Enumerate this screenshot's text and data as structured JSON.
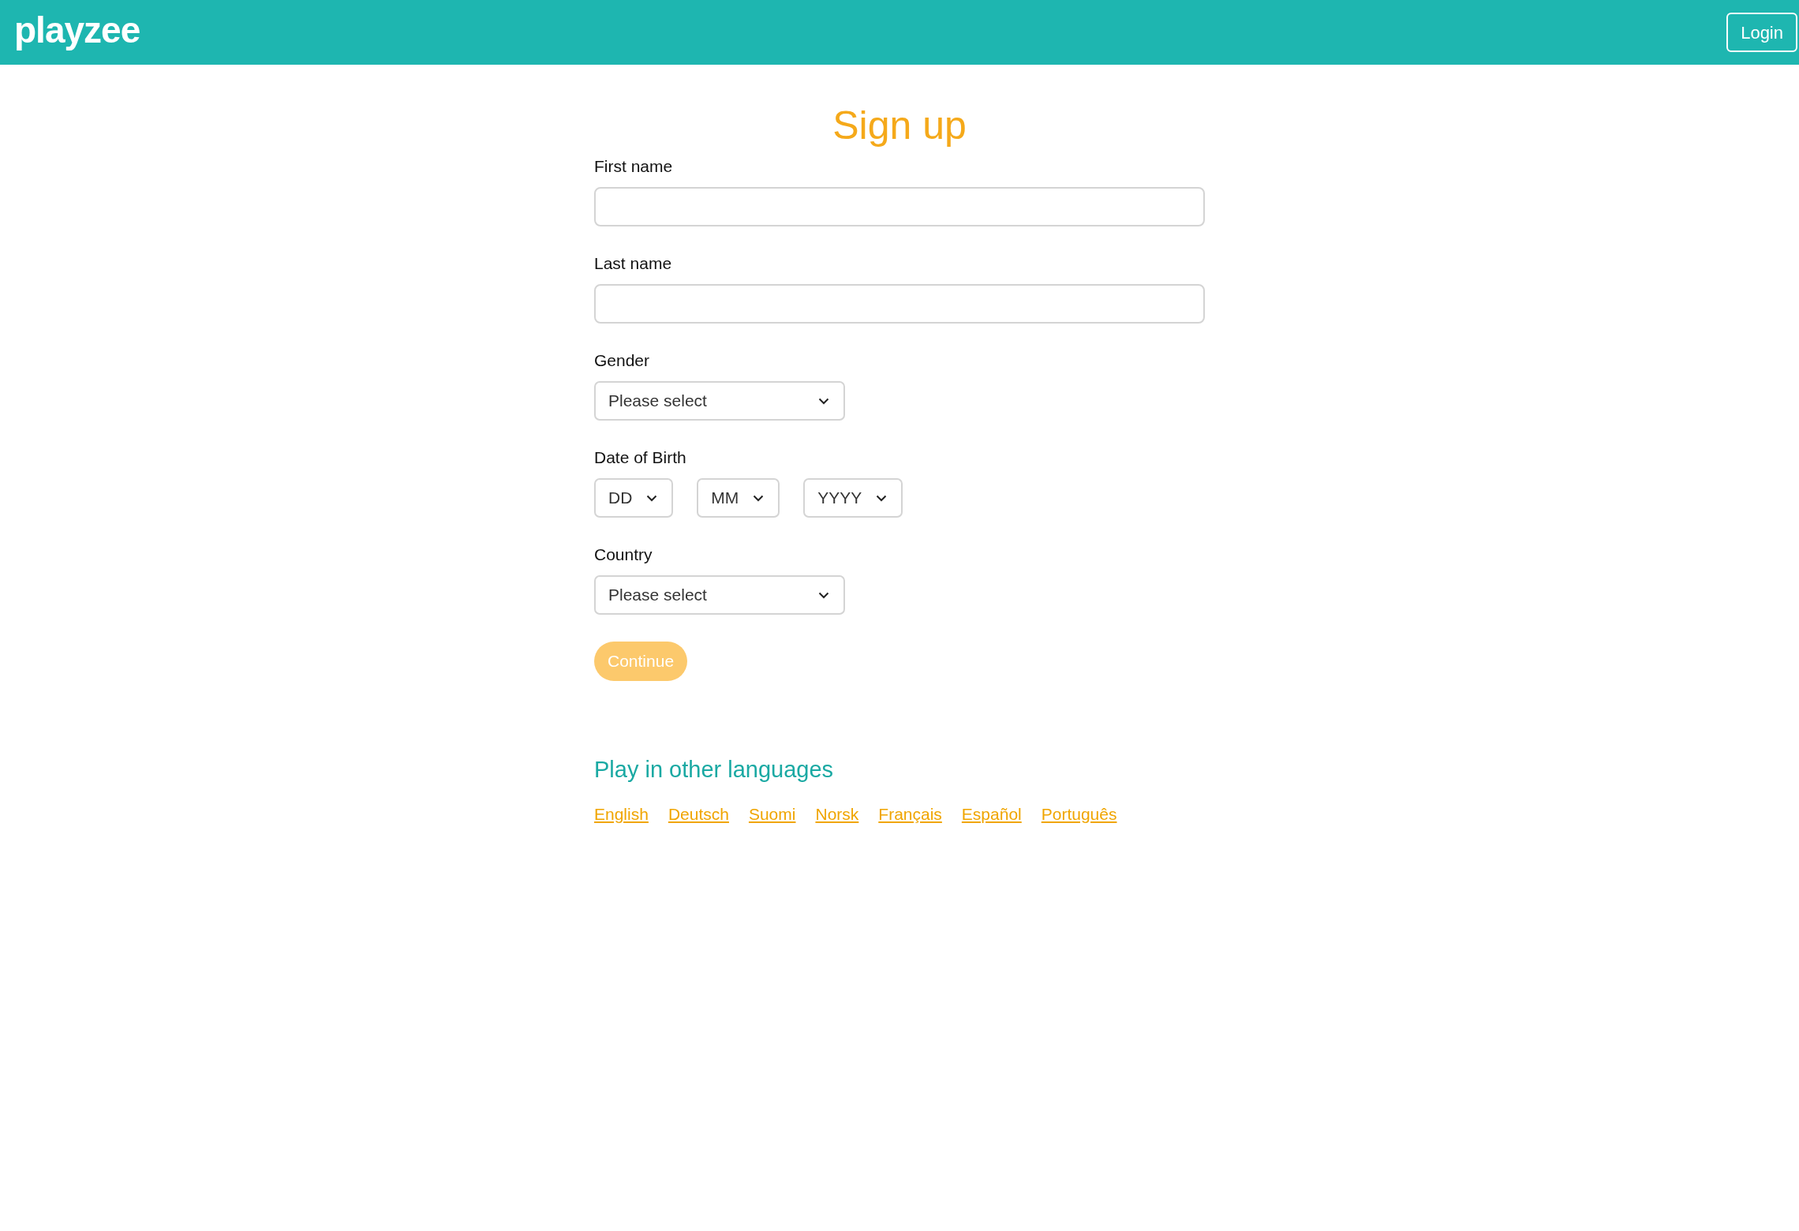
{
  "header": {
    "logo": "playzee",
    "login_button": "Login"
  },
  "title": "Sign up",
  "fields": [
    {
      "kind": "text",
      "label": "First name"
    },
    {
      "kind": "text",
      "label": "Last name"
    },
    {
      "kind": "select",
      "label": "Gender",
      "selects": [
        {
          "value": "Please select"
        }
      ]
    },
    {
      "kind": "select",
      "label": "Date of Birth",
      "selects": [
        {
          "value": "DD"
        },
        {
          "value": "MM"
        },
        {
          "value": "YYYY"
        }
      ]
    },
    {
      "kind": "select",
      "label": "Country",
      "selects": [
        {
          "value": "Please select"
        }
      ]
    }
  ],
  "continue_button": {
    "label": "Continue",
    "disabled": true
  },
  "languages": {
    "heading": "Play in other languages",
    "links": [
      "English",
      "Deutsch",
      "Suomi",
      "Norsk",
      "Français",
      "Español",
      "Português"
    ]
  }
}
